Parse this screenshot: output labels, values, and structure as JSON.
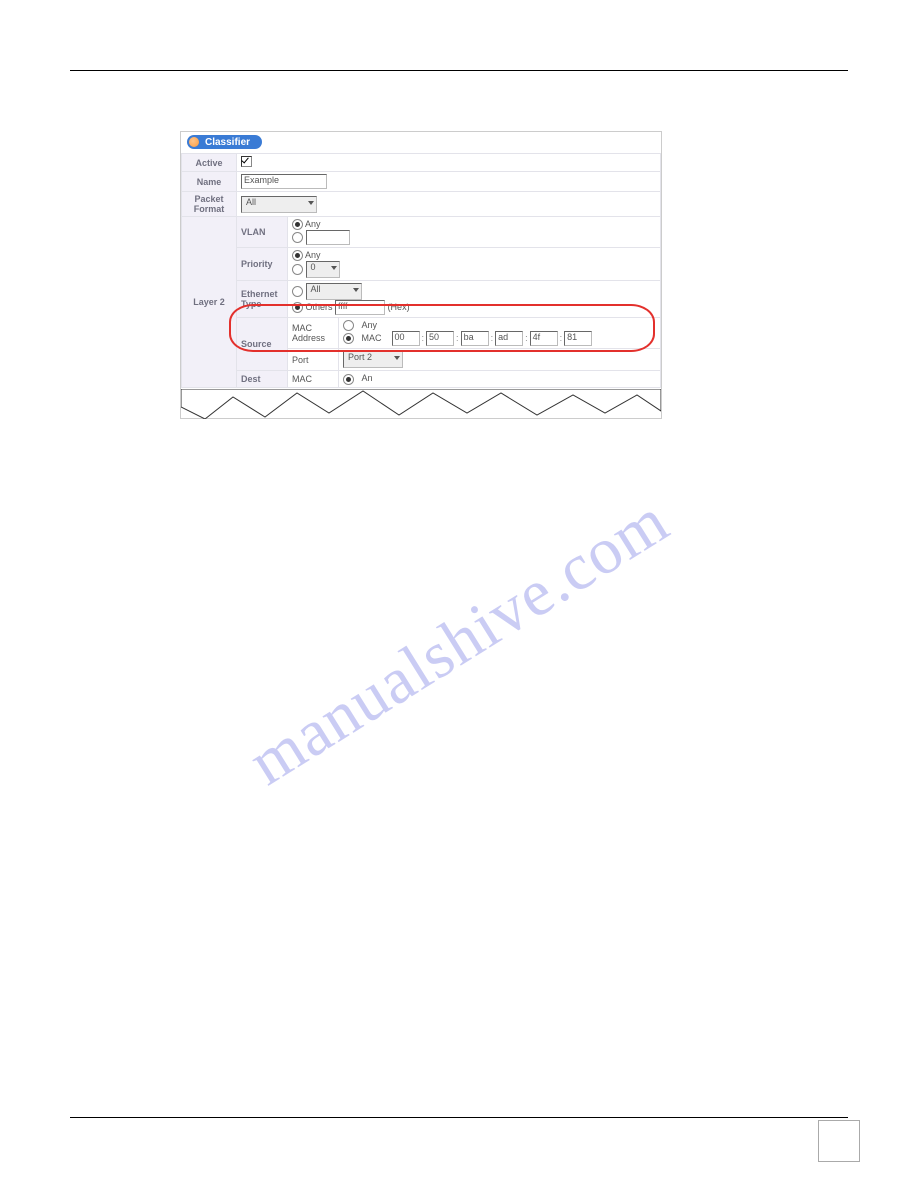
{
  "header": {
    "title": "Classifier"
  },
  "form": {
    "active": {
      "label": "Active",
      "checked": true
    },
    "name": {
      "label": "Name",
      "value": "Example"
    },
    "packet_format": {
      "label_line1": "Packet",
      "label_line2": "Format",
      "value": "All"
    },
    "layer2_label": "Layer 2",
    "vlan": {
      "label": "VLAN",
      "opt_any": "Any",
      "opt_any_checked": true,
      "opt_custom_checked": false,
      "custom_value": ""
    },
    "priority": {
      "label": "Priority",
      "opt_any": "Any",
      "opt_any_checked": true,
      "opt_custom_checked": false,
      "select_value": "0"
    },
    "ethernet_type": {
      "label_line1": "Ethernet",
      "label_line2": "Type",
      "opt_all_checked": false,
      "all_value": "All",
      "opt_others_checked": true,
      "others_label": "Others",
      "others_value": "ffff",
      "suffix": "(Hex)"
    },
    "source": {
      "label": "Source",
      "mac_label": "MAC",
      "address_label": "Address",
      "opt_any": "Any",
      "opt_any_checked": false,
      "opt_mac_label": "MAC",
      "opt_mac_checked": true,
      "mac": [
        "00",
        "50",
        "ba",
        "ad",
        "4f",
        "81"
      ],
      "sep": ":",
      "port_label": "Port",
      "port_value": "Port 2"
    },
    "dest": {
      "label": "Dest",
      "mac_label": "MAC",
      "opt_any": "An",
      "opt_any_checked": true
    }
  },
  "watermark": "manualshive.com"
}
